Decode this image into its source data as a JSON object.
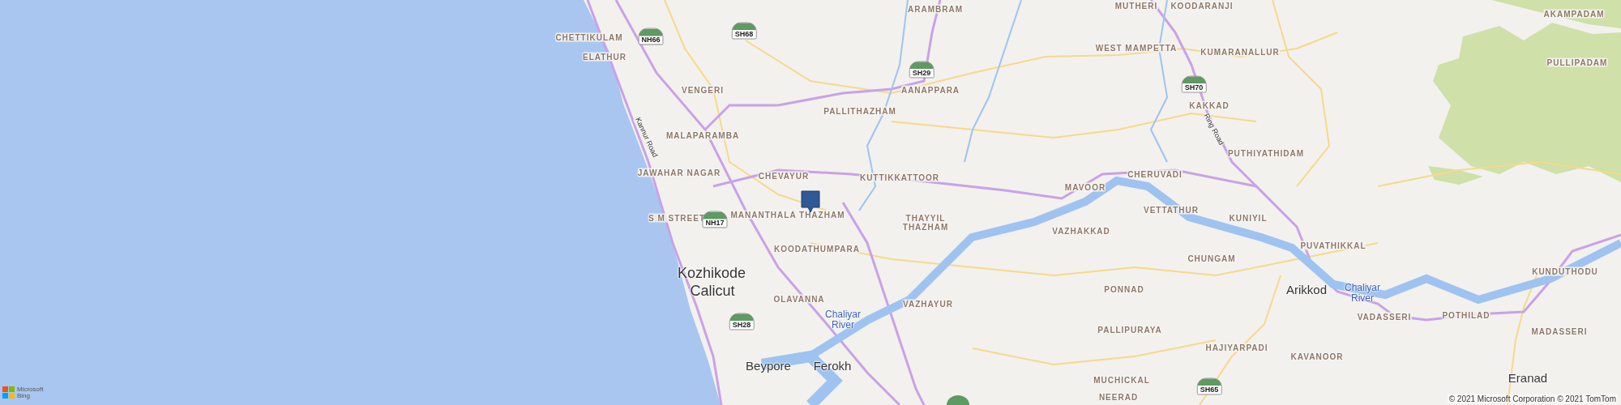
{
  "map": {
    "labels": [
      {
        "text": "ARAMBRAM",
        "kind": "locality"
      },
      {
        "text": "MUTHERI",
        "kind": "locality"
      },
      {
        "text": "KOODARANJI",
        "kind": "locality"
      },
      {
        "text": "AKAMPADAM",
        "kind": "locality"
      },
      {
        "text": "CHETTIKULAM",
        "kind": "locality"
      },
      {
        "text": "ELATHUR",
        "kind": "locality"
      },
      {
        "text": "WEST MAMPETTA",
        "kind": "locality"
      },
      {
        "text": "KUMARANALLUR",
        "kind": "locality"
      },
      {
        "text": "PULLIPADAM",
        "kind": "locality"
      },
      {
        "text": "VENGERI",
        "kind": "locality"
      },
      {
        "text": "AANAPPARA",
        "kind": "locality"
      },
      {
        "text": "PALLITHAZHAM",
        "kind": "locality"
      },
      {
        "text": "KAKKAD",
        "kind": "locality"
      },
      {
        "text": "MALAPARAMBA",
        "kind": "locality"
      },
      {
        "text": "Kannur Road",
        "kind": "road"
      },
      {
        "text": "Ring Road",
        "kind": "road"
      },
      {
        "text": "PUTHIYATHIDAM",
        "kind": "locality"
      },
      {
        "text": "JAWAHAR NAGAR",
        "kind": "locality"
      },
      {
        "text": "CHEVAYUR",
        "kind": "locality"
      },
      {
        "text": "KUTTIKKATTOOR",
        "kind": "locality"
      },
      {
        "text": "CHERUVADI",
        "kind": "locality"
      },
      {
        "text": "MAVOOR",
        "kind": "locality"
      },
      {
        "text": "VETTATHUR",
        "kind": "locality"
      },
      {
        "text": "S M STREET",
        "kind": "locality"
      },
      {
        "text": "MANANTHALA THAZHAM",
        "kind": "locality"
      },
      {
        "text": "THAYYIL THAZHAM",
        "kind": "locality"
      },
      {
        "text": "KUNIYIL",
        "kind": "locality"
      },
      {
        "text": "VAZHAKKAD",
        "kind": "locality"
      },
      {
        "text": "PUVATHIKKAL",
        "kind": "locality"
      },
      {
        "text": "KOODATHUMPARA",
        "kind": "locality"
      },
      {
        "text": "CHUNGAM",
        "kind": "locality"
      },
      {
        "text": "Kozhikode",
        "kind": "city"
      },
      {
        "text": "Calicut",
        "kind": "city"
      },
      {
        "text": "Arikkod",
        "kind": "town"
      },
      {
        "text": "Chaliyar River",
        "kind": "water"
      },
      {
        "text": "KUNDUTHODU",
        "kind": "locality"
      },
      {
        "text": "PONNAD",
        "kind": "locality"
      },
      {
        "text": "OLAVANNA",
        "kind": "locality"
      },
      {
        "text": "VAZHAYUR",
        "kind": "locality"
      },
      {
        "text": "Chaliyar River",
        "kind": "water"
      },
      {
        "text": "VADASSERI",
        "kind": "locality"
      },
      {
        "text": "POTHILAD",
        "kind": "locality"
      },
      {
        "text": "PALLIPURAYA",
        "kind": "locality"
      },
      {
        "text": "MADASSERI",
        "kind": "locality"
      },
      {
        "text": "HAJIYARPADI",
        "kind": "locality"
      },
      {
        "text": "KAVANOOR",
        "kind": "locality"
      },
      {
        "text": "Beypore",
        "kind": "town"
      },
      {
        "text": "Ferokh",
        "kind": "town"
      },
      {
        "text": "MUCHICKAL",
        "kind": "locality"
      },
      {
        "text": "Eranad",
        "kind": "town"
      },
      {
        "text": "NEERAD",
        "kind": "locality"
      }
    ],
    "shields": [
      "NH66",
      "SH68",
      "SH29",
      "SH70",
      "NH17",
      "SH28",
      "SH65"
    ],
    "logo": [
      "Microsoft",
      "Bing"
    ],
    "attribution": "© 2021 Microsoft Corporation © 2021 TomTom"
  }
}
